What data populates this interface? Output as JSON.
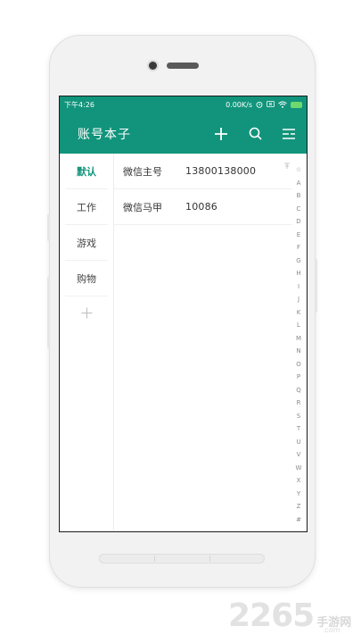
{
  "status_bar": {
    "time": "下午4:26",
    "network_speed": "0.00K/s",
    "battery_color": "#6fd86f"
  },
  "app_bar": {
    "title": "账号本子",
    "actions": [
      "add-icon",
      "search-icon",
      "menu-icon"
    ],
    "color": "#11947b"
  },
  "sidebar": {
    "items": [
      {
        "label": "默认",
        "active": true
      },
      {
        "label": "工作",
        "active": false
      },
      {
        "label": "游戏",
        "active": false
      },
      {
        "label": "购物",
        "active": false
      }
    ],
    "add_icon": "plus-icon"
  },
  "accounts": [
    {
      "name": "微信主号",
      "value": "13800138000",
      "pinned": true
    },
    {
      "name": "微信马甲",
      "value": "10086",
      "pinned": false
    }
  ],
  "alpha_index": [
    "☆",
    "A",
    "B",
    "C",
    "D",
    "E",
    "F",
    "G",
    "H",
    "I",
    "J",
    "K",
    "L",
    "M",
    "N",
    "O",
    "P",
    "Q",
    "R",
    "S",
    "T",
    "U",
    "V",
    "W",
    "X",
    "Y",
    "Z",
    "#"
  ],
  "watermark": {
    "number": "2265",
    "text": "手游网",
    "url": ".com"
  }
}
